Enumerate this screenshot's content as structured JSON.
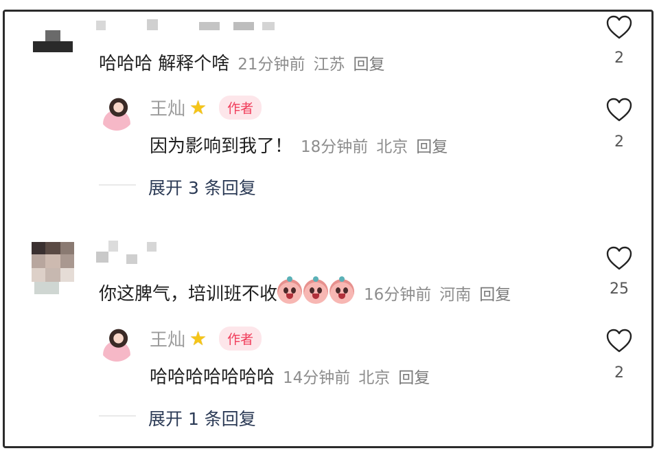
{
  "comments": [
    {
      "text": "哈哈哈 解释个啥",
      "time": "21分钟前",
      "location": "江苏",
      "reply_label": "回复",
      "likes": "2",
      "replies": [
        {
          "author": "王灿",
          "author_badge": "作者",
          "text": "因为影响到我了！",
          "time": "18分钟前",
          "location": "北京",
          "reply_label": "回复",
          "likes": "2"
        }
      ],
      "expand_label": "展开 3 条回复"
    },
    {
      "text": "你这脾气，培训班不收",
      "emoji_name": "crying-pig-emoji",
      "time": "16分钟前",
      "location": "河南",
      "reply_label": "回复",
      "likes": "25",
      "replies": [
        {
          "author": "王灿",
          "author_badge": "作者",
          "text": "哈哈哈哈哈哈哈",
          "time": "14分钟前",
          "location": "北京",
          "reply_label": "回复",
          "likes": "2"
        }
      ],
      "expand_label": "展开 1 条回复"
    }
  ],
  "icons": {
    "like": "heart-outline-icon",
    "verified": "star-icon"
  },
  "colors": {
    "badge_bg": "#fde6ea",
    "badge_text": "#f03c5a",
    "expand_text": "#2b3a55",
    "meta_text": "#8d8d8d"
  }
}
